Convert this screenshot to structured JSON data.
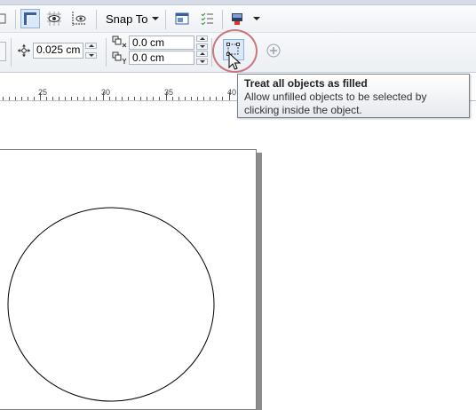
{
  "toolbar_top": {
    "snap_to_label": "Snap To"
  },
  "toolbar_property": {
    "nudge_distance_value": "0.025 cm",
    "duplicate_distance_x": "0.0 cm",
    "duplicate_distance_y": "0.0 cm"
  },
  "ruler": {
    "ticks": [
      "25",
      "30",
      "35",
      "40"
    ]
  },
  "tooltip": {
    "title": "Treat all objects as filled",
    "description": "Allow unfilled objects to be selected by clicking inside the object."
  },
  "colors": {
    "highlight_circle": "#c9777a",
    "pressed_button_bg": "#dbe8f7",
    "page_shadow": "#8c8c8c"
  },
  "icons": {
    "treat_filled": "treat-objects-as-filled-icon",
    "add": "add-preset-icon",
    "nudge": "nudge-move-icon"
  }
}
